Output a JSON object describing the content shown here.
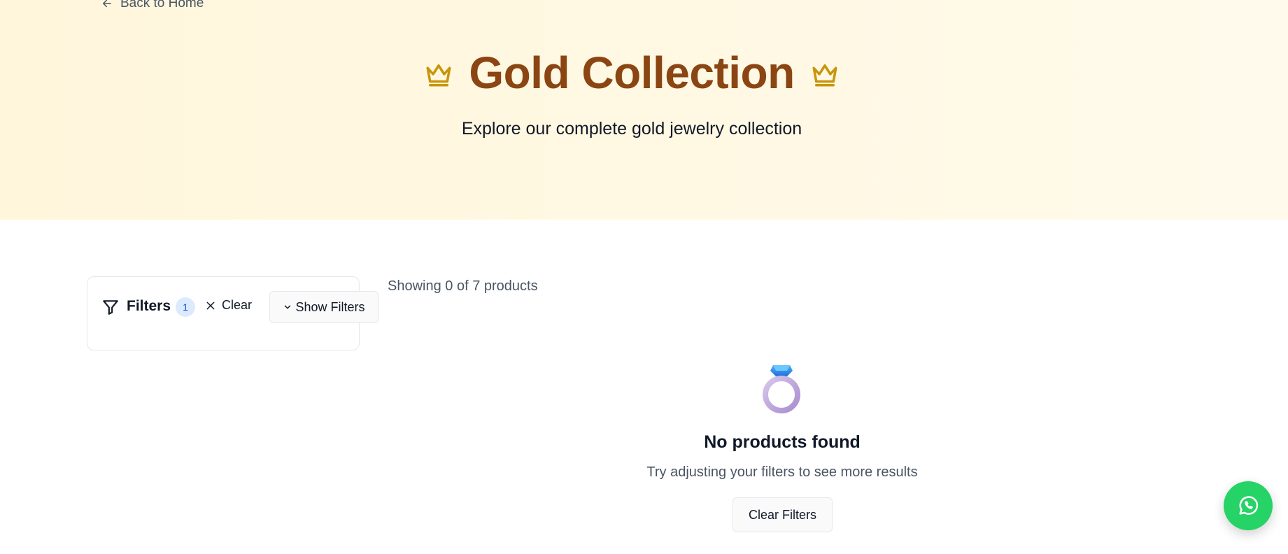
{
  "hero": {
    "back_label": "Back to Home",
    "title": "Gold Collection",
    "subtitle": "Explore our complete gold jewelry collection"
  },
  "filters": {
    "label": "Filters",
    "active_count": "1",
    "clear_label": "Clear",
    "toggle_label": "Show Filters"
  },
  "results": {
    "showing_text": "Showing 0 of 7 products"
  },
  "empty_state": {
    "icon": "ring-icon",
    "title": "No products found",
    "message": "Try adjusting your filters to see more results",
    "button_label": "Clear Filters"
  },
  "floating": {
    "icon": "whatsapp-icon"
  },
  "colors": {
    "hero_background": "#fff6dc",
    "title": "#8b4513",
    "crown": "#c8950b",
    "whatsapp": "#25d366"
  }
}
